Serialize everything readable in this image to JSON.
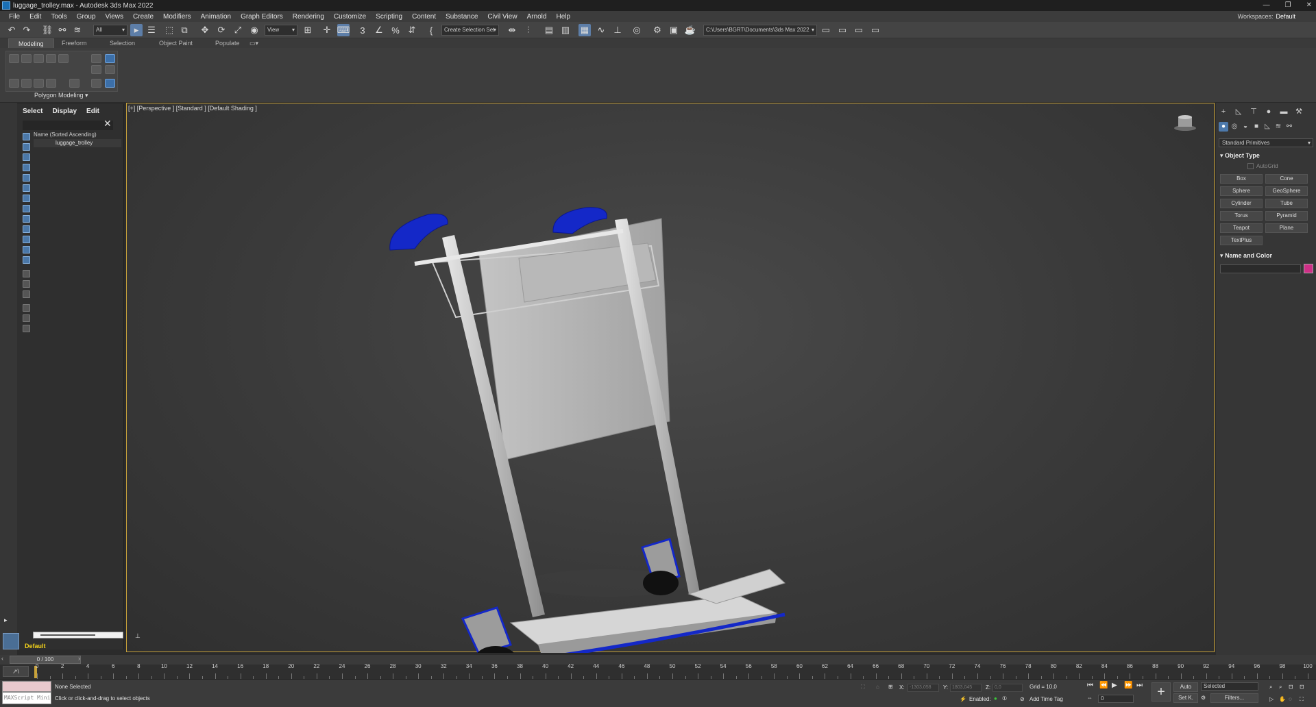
{
  "window": {
    "title": "luggage_trolley.max - Autodesk 3ds Max 2022",
    "controls": [
      "—",
      "❐",
      "✕"
    ]
  },
  "menu": {
    "items": [
      "File",
      "Edit",
      "Tools",
      "Group",
      "Views",
      "Create",
      "Modifiers",
      "Animation",
      "Graph Editors",
      "Rendering",
      "Customize",
      "Scripting",
      "Content",
      "Substance",
      "Civil View",
      "Arnold",
      "Help"
    ],
    "workspace_label": "Workspaces:",
    "workspace_value": "Default"
  },
  "toolbar": {
    "filter_select": "All",
    "ref_coord": "View",
    "selection_set": "Create Selection Set",
    "project_path": "C:\\Users\\BGRT\\Documents\\3ds Max 2022"
  },
  "ribbon": {
    "tabs": [
      "Modeling",
      "Freeform",
      "Selection",
      "Object Paint",
      "Populate"
    ],
    "panel_label": "Polygon Modeling ▾"
  },
  "scene_explorer": {
    "tabs": [
      "Select",
      "Display",
      "Edit"
    ],
    "column_header": "Name (Sorted Ascending)",
    "objects": [
      {
        "name": "luggage_trolley"
      }
    ],
    "layer_name": "Default"
  },
  "viewport": {
    "label": "[+] [Perspective ] [Standard ] [Default Shading ]"
  },
  "command_panel": {
    "category": "Standard Primitives",
    "object_type_title": "Object Type",
    "autogrid_label": "AutoGrid",
    "primitives": [
      "Box",
      "Cone",
      "Sphere",
      "GeoSphere",
      "Cylinder",
      "Tube",
      "Torus",
      "Pyramid",
      "Teapot",
      "Plane",
      "TextPlus"
    ],
    "name_color_title": "Name and Color",
    "object_color": "#cf2f87"
  },
  "timeline": {
    "frame_display": "0 / 100",
    "ticks": [
      "0",
      "2",
      "4",
      "6",
      "8",
      "10",
      "12",
      "14",
      "16",
      "18",
      "20",
      "22",
      "24",
      "26",
      "28",
      "30",
      "32",
      "34",
      "36",
      "38",
      "40",
      "42",
      "44",
      "46",
      "48",
      "50",
      "52",
      "54",
      "56",
      "58",
      "60",
      "62",
      "64",
      "66",
      "68",
      "70",
      "72",
      "74",
      "76",
      "78",
      "80",
      "82",
      "84",
      "86",
      "88",
      "90",
      "92",
      "94",
      "96",
      "98",
      "100"
    ]
  },
  "status": {
    "maxscript_label": "MAXScript Mini",
    "selection_status": "None Selected",
    "prompt": "Click or click-and-drag to select objects",
    "x_label": "X:",
    "x_value": "-1303,058",
    "y_label": "Y:",
    "y_value": "1803,045",
    "z_label": "Z:",
    "z_value": "0,0",
    "grid": "Grid = 10,0",
    "enabled_label": "Enabled:",
    "add_time_tag": "Add Time Tag",
    "auto_key": "Auto",
    "set_key": "Set K.",
    "key_filter_select": "Selected",
    "filters": "Filters...",
    "current_frame": "0"
  }
}
